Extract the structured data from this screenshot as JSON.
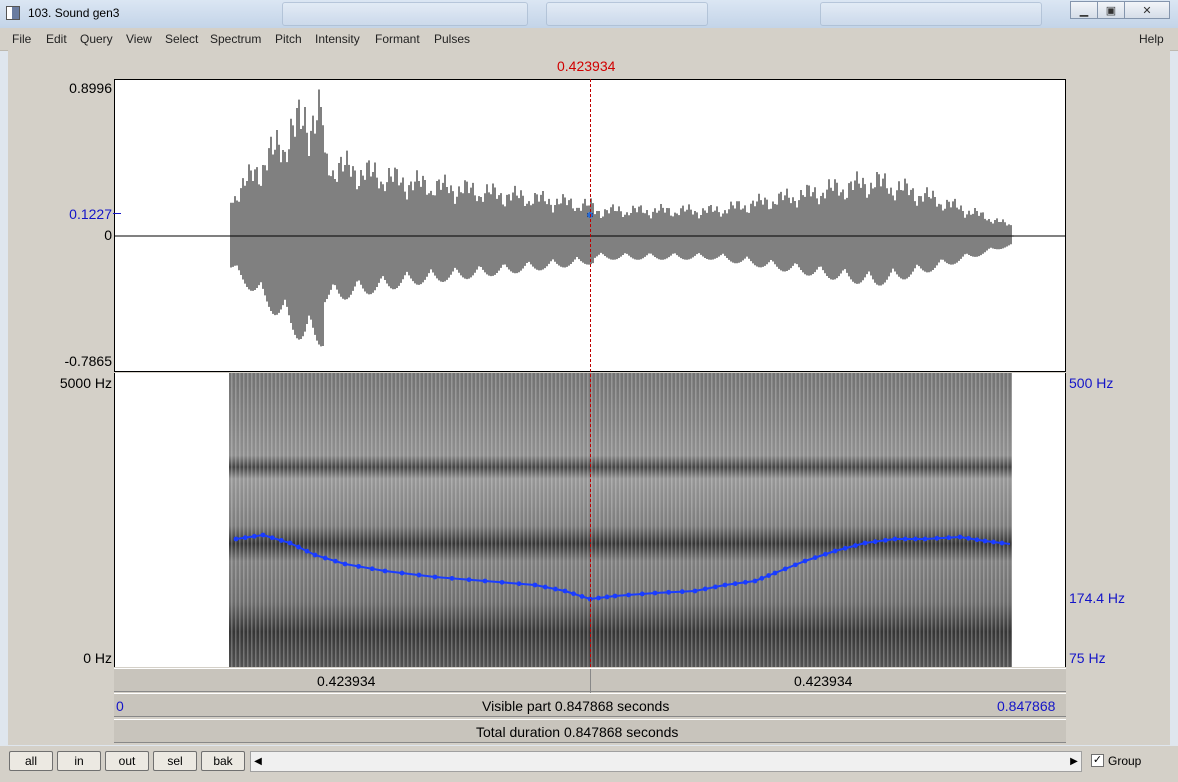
{
  "window": {
    "title": "103. Sound gen3"
  },
  "menu": [
    "File",
    "Edit",
    "Query",
    "View",
    "Select",
    "Spectrum",
    "Pitch",
    "Intensity",
    "Formant",
    "Pulses"
  ],
  "help_label": "Help",
  "cursor": {
    "time_label": "0.423934"
  },
  "waveform": {
    "max_label": "0.8996",
    "cursor_value_label": "0.1227",
    "zero_label": "0",
    "min_label": "-0.7865"
  },
  "spectrogram": {
    "top_label": "5000 Hz",
    "bottom_label": "0 Hz"
  },
  "pitch": {
    "top_label": "500 Hz",
    "cursor_label": "174.4 Hz",
    "bottom_label": "75 Hz"
  },
  "time_bars": {
    "left_half": "0.423934",
    "right_half": "0.423934",
    "visible_start": "0",
    "visible_text": "Visible part 0.847868 seconds",
    "visible_end": "0.847868",
    "total_text": "Total duration 0.847868 seconds"
  },
  "buttons": {
    "all": "all",
    "in": "in",
    "out": "out",
    "sel": "sel",
    "bak": "bak"
  },
  "group_label": "Group",
  "colors": {
    "cursor": "#d00000",
    "pitch": "#1a3cff",
    "axis_blue": "#1414c8"
  }
}
